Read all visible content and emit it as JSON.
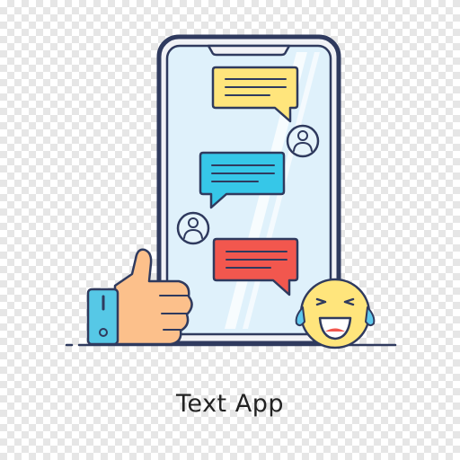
{
  "caption": "Text App",
  "colors": {
    "outline": "#2f3a5e",
    "screen": "#dff1fb",
    "frame": "#f1f2f6",
    "bubble_yellow": "#ffe57c",
    "bubble_blue": "#36c7e8",
    "bubble_red": "#f2574e",
    "skin": "#fcc08b",
    "cuff": "#56c8e6",
    "emoji": "#ffe57c",
    "tears": "#5ec9ee"
  },
  "icons": [
    "smartphone-icon",
    "chat-bubble-icon",
    "user-avatar-icon",
    "thumbs-up-icon",
    "laughing-emoji-icon"
  ]
}
